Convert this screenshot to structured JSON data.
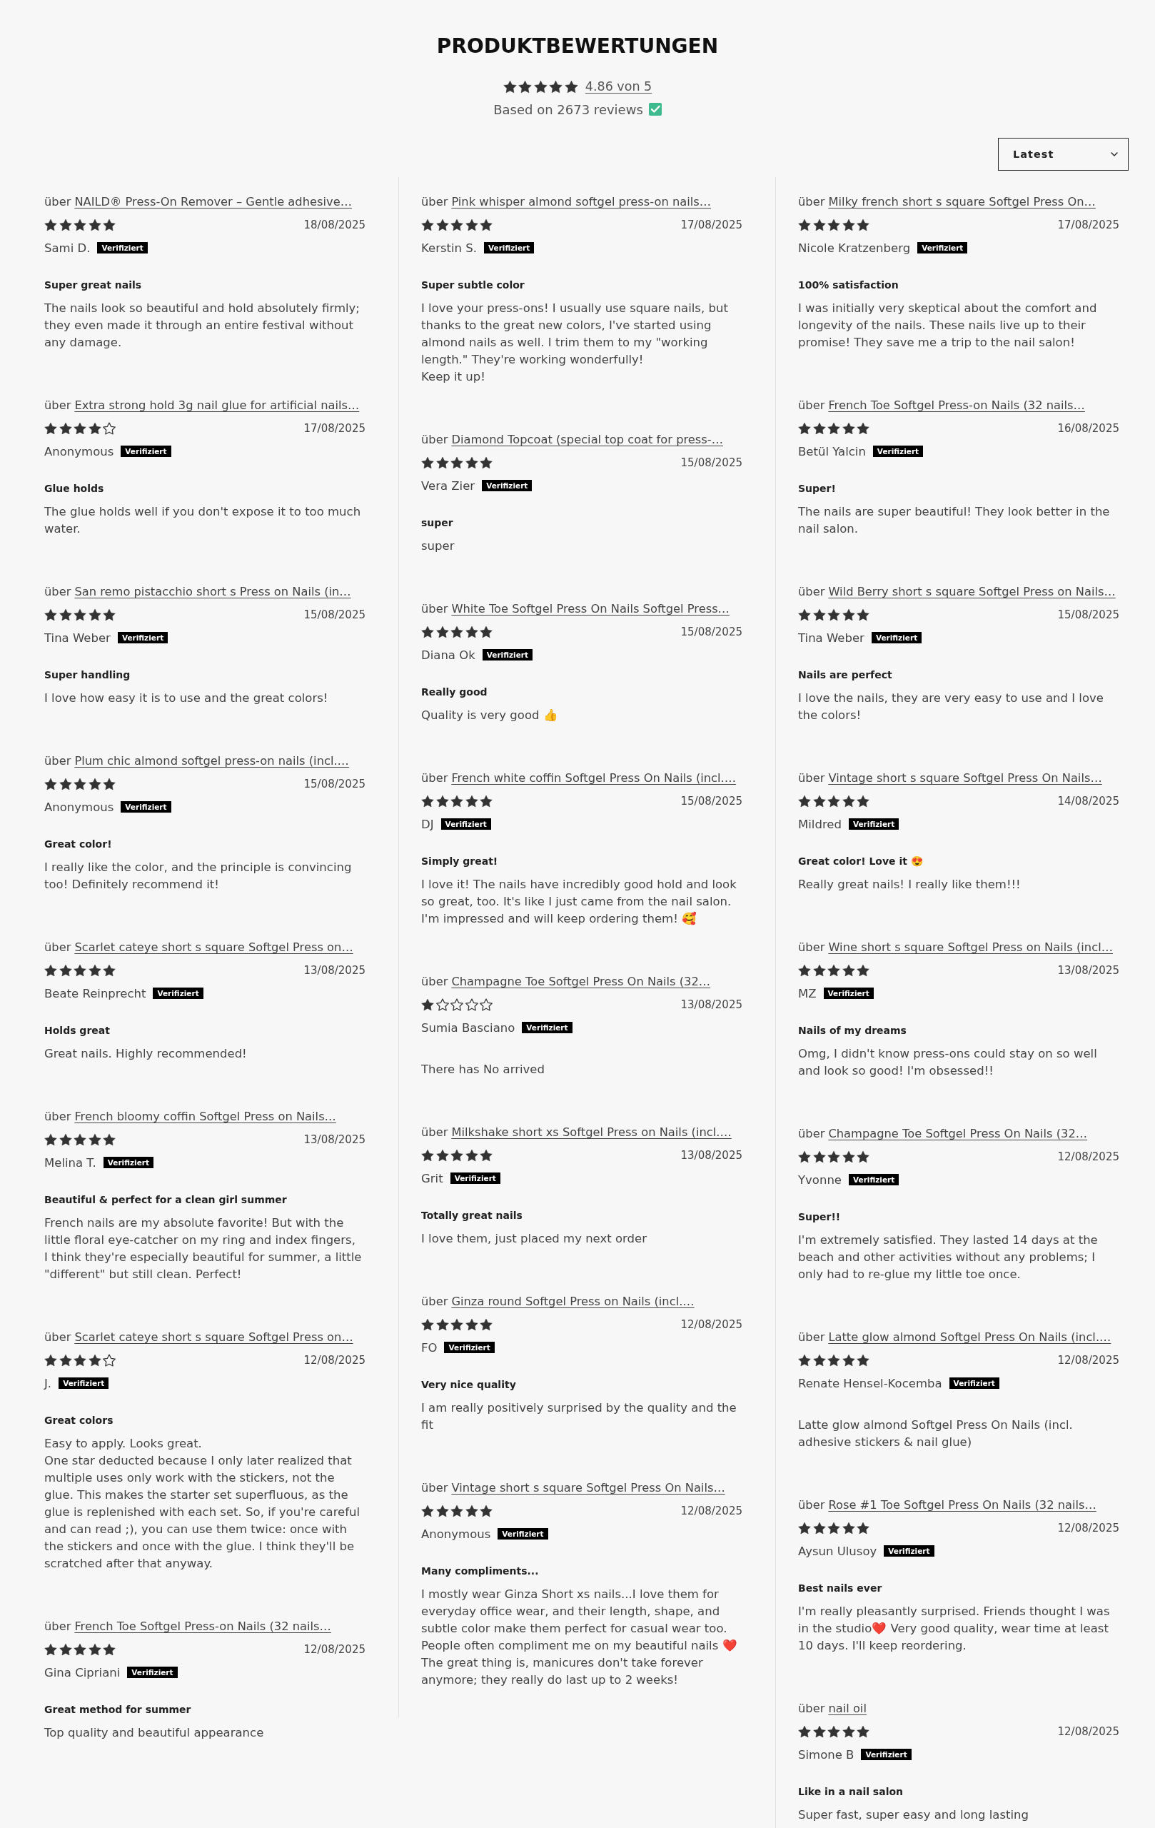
{
  "header": {
    "title": "PRODUKTBEWERTUNGEN",
    "rating": {
      "stars": 5,
      "score": "4.86 von 5"
    },
    "review_count": "Based on 2673 reviews"
  },
  "sort": {
    "value": "Latest"
  },
  "columns": [
    {
      "reviews": [
        {
          "prefix": "über",
          "product": "NAILD® Press-On Remover – Gentle adhesive…",
          "stars": 5,
          "date": "18/08/2025",
          "author": "Sami D.",
          "badge": "Verifiziert",
          "title": "Super great nails",
          "body": "The nails look so beautiful and hold absolutely firmly; they even made it through an entire festival without any damage."
        },
        {
          "prefix": "über",
          "product": "Extra strong hold 3g nail glue for artificial nails…",
          "stars": 4,
          "date": "17/08/2025",
          "author": "Anonymous",
          "badge": "Verifiziert",
          "title": "Glue holds",
          "body": "The glue holds well if you don't expose it to too much water."
        },
        {
          "prefix": "über",
          "product": "San remo pistacchio short s Press on Nails (in…",
          "stars": 5,
          "date": "15/08/2025",
          "author": "Tina Weber",
          "badge": "Verifiziert",
          "title": "Super handling",
          "body": "I love how easy it is to use and the great colors!"
        },
        {
          "prefix": "über",
          "product": "Plum chic almond softgel press-on nails (incl.…",
          "stars": 5,
          "date": "15/08/2025",
          "author": "Anonymous",
          "badge": "Verifiziert",
          "title": "Great color!",
          "body": "I really like the color, and the principle is convincing too! Definitely recommend it!"
        },
        {
          "prefix": "über",
          "product": "Scarlet cateye short s square Softgel Press on…",
          "stars": 5,
          "date": "13/08/2025",
          "author": "Beate Reinprecht",
          "badge": "Verifiziert",
          "title": "Holds great",
          "body": "Great nails. Highly recommended!"
        },
        {
          "prefix": "über",
          "product": "French bloomy coffin Softgel Press on Nails…",
          "stars": 5,
          "date": "13/08/2025",
          "author": "Melina T.",
          "badge": "Verifiziert",
          "title": "Beautiful & perfect for a clean girl summer",
          "body": "French nails are my absolute favorite! But with the little floral eye-catcher on my ring and index fingers, I think they're especially beautiful for summer, a little \"different\" but still clean. Perfect!"
        },
        {
          "prefix": "über",
          "product": "Scarlet cateye short s square Softgel Press on…",
          "stars": 4,
          "date": "12/08/2025",
          "author": "J.",
          "badge": "Verifiziert",
          "title": "Great colors",
          "body": "Easy to apply. Looks great.\nOne star deducted because I only later realized that multiple uses only work with the stickers, not the glue. This makes the starter set superfluous, as the glue is replenished with each set. So, if you're careful and can read ;), you can use them twice: once with the stickers and once with the glue. I think they'll be scratched after that anyway."
        },
        {
          "prefix": "über",
          "product": "French Toe Softgel Press-on Nails (32 nails…",
          "stars": 5,
          "date": "12/08/2025",
          "author": "Gina Cipriani",
          "badge": "Verifiziert",
          "title": "Great method for summer",
          "body": "Top quality and beautiful appearance"
        }
      ]
    },
    {
      "reviews": [
        {
          "prefix": "über",
          "product": "Pink whisper almond softgel press-on nails…",
          "stars": 5,
          "date": "17/08/2025",
          "author": "Kerstin S.",
          "badge": "Verifiziert",
          "title": "Super subtle color",
          "body": "I love your press-ons! I usually use square nails, but thanks to the great new colors, I've started using almond nails as well. I trim them to my \"working length.\" They're working wonderfully!\nKeep it up!"
        },
        {
          "prefix": "über",
          "product": "Diamond Topcoat (special top coat for press-…",
          "stars": 5,
          "date": "15/08/2025",
          "author": "Vera Zier",
          "badge": "Verifiziert",
          "title": "super",
          "body": "super"
        },
        {
          "prefix": "über",
          "product": "White Toe Softgel Press On Nails Softgel Press…",
          "stars": 5,
          "date": "15/08/2025",
          "author": "Diana Ok",
          "badge": "Verifiziert",
          "title": "Really good",
          "body": "Quality is very good 👍"
        },
        {
          "prefix": "über",
          "product": "French white coffin Softgel Press On Nails (incl.…",
          "stars": 5,
          "date": "15/08/2025",
          "author": "DJ",
          "badge": "Verifiziert",
          "title": "Simply great!",
          "body": "I love it! The nails have incredibly good hold and look so great, too. It's like I just came from the nail salon. I'm impressed and will keep ordering them! 🥰"
        },
        {
          "prefix": "über",
          "product": "Champagne Toe Softgel Press On Nails (32…",
          "stars": 1,
          "date": "13/08/2025",
          "author": "Sumia Basciano",
          "badge": "Verifiziert",
          "body": "There has No arrived"
        },
        {
          "prefix": "über",
          "product": "Milkshake short xs Softgel Press on Nails (incl.…",
          "stars": 5,
          "date": "13/08/2025",
          "author": "Grit",
          "badge": "Verifiziert",
          "title": "Totally great nails",
          "body": "I love them, just placed my next order"
        },
        {
          "prefix": "über",
          "product": "Ginza round Softgel Press on Nails (incl.…",
          "stars": 5,
          "date": "12/08/2025",
          "author": "FO",
          "badge": "Verifiziert",
          "title": "Very nice quality",
          "body": "I am really positively surprised by the quality and the fit"
        },
        {
          "prefix": "über",
          "product": "Vintage short s square Softgel Press On Nails…",
          "stars": 5,
          "date": "12/08/2025",
          "author": "Anonymous",
          "badge": "Verifiziert",
          "title": "Many compliments...",
          "body": "I mostly wear Ginza Short xs nails...I love them for everyday office wear, and their length, shape, and subtle color make them perfect for casual wear too. People often compliment me on my beautiful nails ❤️ The great thing is, manicures don't take forever anymore; they really do last up to 2 weeks!"
        }
      ]
    },
    {
      "reviews": [
        {
          "prefix": "über",
          "product": "Milky french short s square Softgel Press On…",
          "stars": 5,
          "date": "17/08/2025",
          "author": "Nicole Kratzenberg",
          "badge": "Verifiziert",
          "title": "100% satisfaction",
          "body": "I was initially very skeptical about the comfort and longevity of the nails. These nails live up to their promise! They save me a trip to the nail salon!"
        },
        {
          "prefix": "über",
          "product": "French Toe Softgel Press-on Nails (32 nails…",
          "stars": 5,
          "date": "16/08/2025",
          "author": "Betül Yalcin",
          "badge": "Verifiziert",
          "title": "Super!",
          "body": "The nails are super beautiful! They look better in the nail salon."
        },
        {
          "prefix": "über",
          "product": "Wild Berry short s square Softgel Press on Nails…",
          "stars": 5,
          "date": "15/08/2025",
          "author": "Tina Weber",
          "badge": "Verifiziert",
          "title": "Nails are perfect",
          "body": "I love the nails, they are very easy to use and I love the colors!"
        },
        {
          "prefix": "über",
          "product": "Vintage short s square Softgel Press On Nails…",
          "stars": 5,
          "date": "14/08/2025",
          "author": "Mildred",
          "badge": "Verifiziert",
          "title": "Great color! Love it 😍",
          "body": "Really great nails! I really like them!!!"
        },
        {
          "prefix": "über",
          "product": "Wine short s square Softgel Press on Nails (incl…",
          "stars": 5,
          "date": "13/08/2025",
          "author": "MZ",
          "badge": "Verifiziert",
          "title": "Nails of my dreams",
          "body": "Omg, I didn't know press-ons could stay on so well and look so good! I'm obsessed!!"
        },
        {
          "prefix": "über",
          "product": "Champagne Toe Softgel Press On Nails (32…",
          "stars": 5,
          "date": "12/08/2025",
          "author": "Yvonne",
          "badge": "Verifiziert",
          "title": "Super!!",
          "body": "I'm extremely satisfied. They lasted 14 days at the beach and other activities without any problems; I only had to re-glue my little toe once."
        },
        {
          "prefix": "über",
          "product": "Latte glow almond Softgel Press On Nails (incl.…",
          "stars": 5,
          "date": "12/08/2025",
          "author": "Renate Hensel-Kocemba",
          "badge": "Verifiziert",
          "body": "Latte glow almond Softgel Press On Nails (incl. adhesive stickers & nail glue)"
        },
        {
          "prefix": "über",
          "product": "Rose #1 Toe Softgel Press On Nails (32 nails…",
          "stars": 5,
          "date": "12/08/2025",
          "author": "Aysun Ulusoy",
          "badge": "Verifiziert",
          "title": "Best nails ever",
          "body": "I'm really pleasantly surprised. Friends thought I was in the studio❤️ Very good quality, wear time at least 10 days. I'll keep reordering."
        },
        {
          "prefix": "über",
          "product": "nail oil",
          "stars": 5,
          "date": "12/08/2025",
          "author": "Simone B",
          "badge": "Verifiziert",
          "title": "Like in a nail salon",
          "body": "Super fast, super easy and long lasting"
        }
      ]
    }
  ]
}
